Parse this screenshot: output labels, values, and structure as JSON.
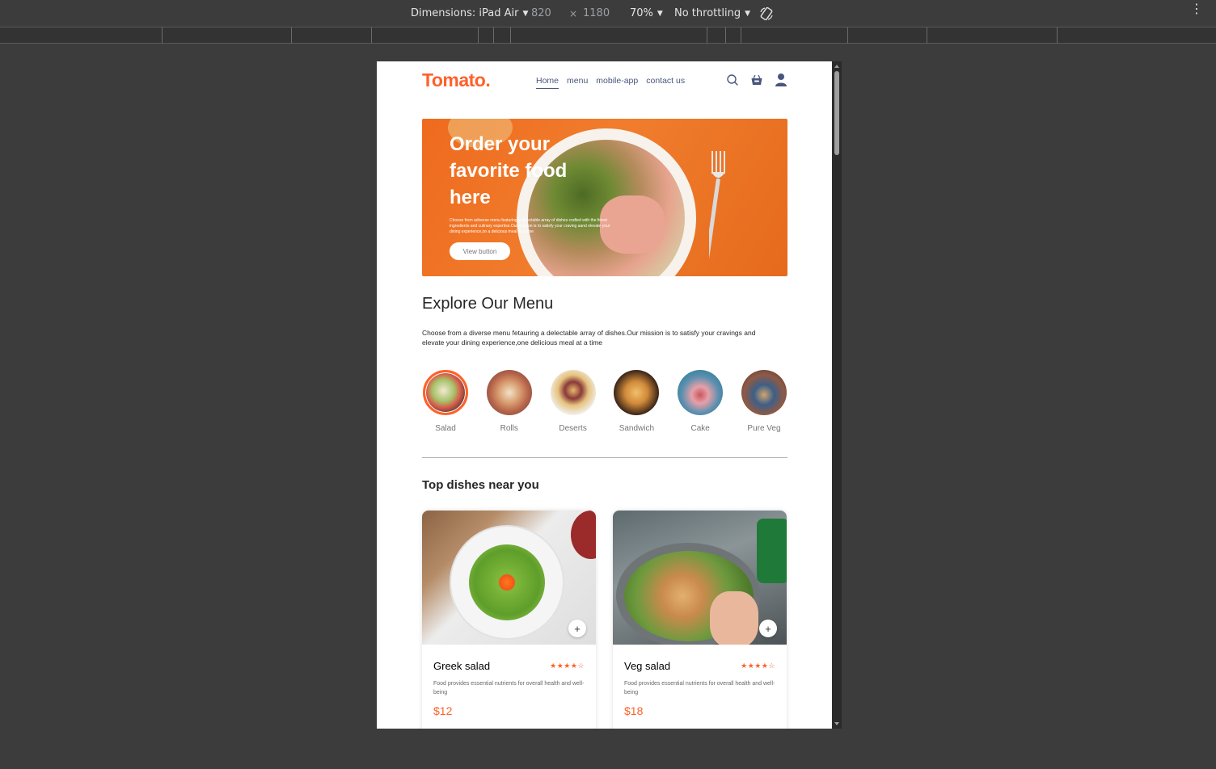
{
  "devtools": {
    "dimensions_label": "Dimensions: iPad Air",
    "width": "820",
    "times": "×",
    "height": "1180",
    "zoom": "70%",
    "throttling": "No throttling"
  },
  "colors": {
    "accent": "#ff6129",
    "nav_text": "#49557e",
    "devtools_bg": "#3c3c3c"
  },
  "navbar": {
    "logo": "Tomato.",
    "links": [
      "Home",
      "menu",
      "mobile-app",
      "contact us"
    ],
    "active_link": "Home",
    "icons": [
      "search-icon",
      "basket-icon",
      "user-icon"
    ]
  },
  "hero": {
    "title": "Order your favorite food here",
    "description": "Choose from adiverse menu featuring a delectable array of dishes crafted with the finest ingredients and culinary expertise.Our mission is to satisfy your craving aand elevate your dining experience,on a delicious meal at a time",
    "button": "View button"
  },
  "explore": {
    "title": "Explore Our Menu",
    "description": "Choose from a diverse menu fetauring a delectable array of dishes.Our mission is to satisfy your cravings and elevate your dining experience,one delicious meal at a time",
    "categories": [
      {
        "label": "Salad",
        "active": true
      },
      {
        "label": "Rolls",
        "active": false
      },
      {
        "label": "Deserts",
        "active": false
      },
      {
        "label": "Sandwich",
        "active": false
      },
      {
        "label": "Cake",
        "active": false
      },
      {
        "label": "Pure Veg",
        "active": false
      }
    ]
  },
  "dishes": {
    "title": "Top dishes near you",
    "items": [
      {
        "name": "Greek salad",
        "rating": 4,
        "stars": "★★★★☆",
        "description": "Food provides essential nutrients for overall health and well-being",
        "price": "$12"
      },
      {
        "name": "Veg salad",
        "rating": 4,
        "stars": "★★★★☆",
        "description": "Food provides essential nutrients for overall health and well-being",
        "price": "$18"
      }
    ],
    "add_symbol": "+"
  }
}
